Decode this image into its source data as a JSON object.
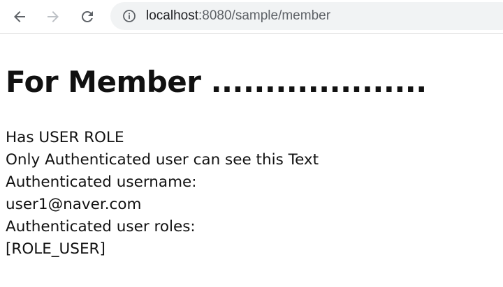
{
  "browser": {
    "url_host": "localhost",
    "url_rest": ":8080/sample/member",
    "icons": {
      "back": "back-arrow-icon",
      "forward": "forward-arrow-icon",
      "reload": "reload-icon",
      "site_info": "info-icon"
    },
    "colors": {
      "toolbar_bg": "#ffffff",
      "omnibox_bg": "#f1f3f4",
      "active_icon": "#5f6368",
      "disabled_icon": "#bdc1c6"
    }
  },
  "page": {
    "heading": "For Member ....................",
    "lines": [
      "Has USER ROLE",
      "Only Authenticated user can see this Text",
      "Authenticated username:",
      "user1@naver.com",
      "Authenticated user roles:",
      "[ROLE_USER]"
    ]
  }
}
